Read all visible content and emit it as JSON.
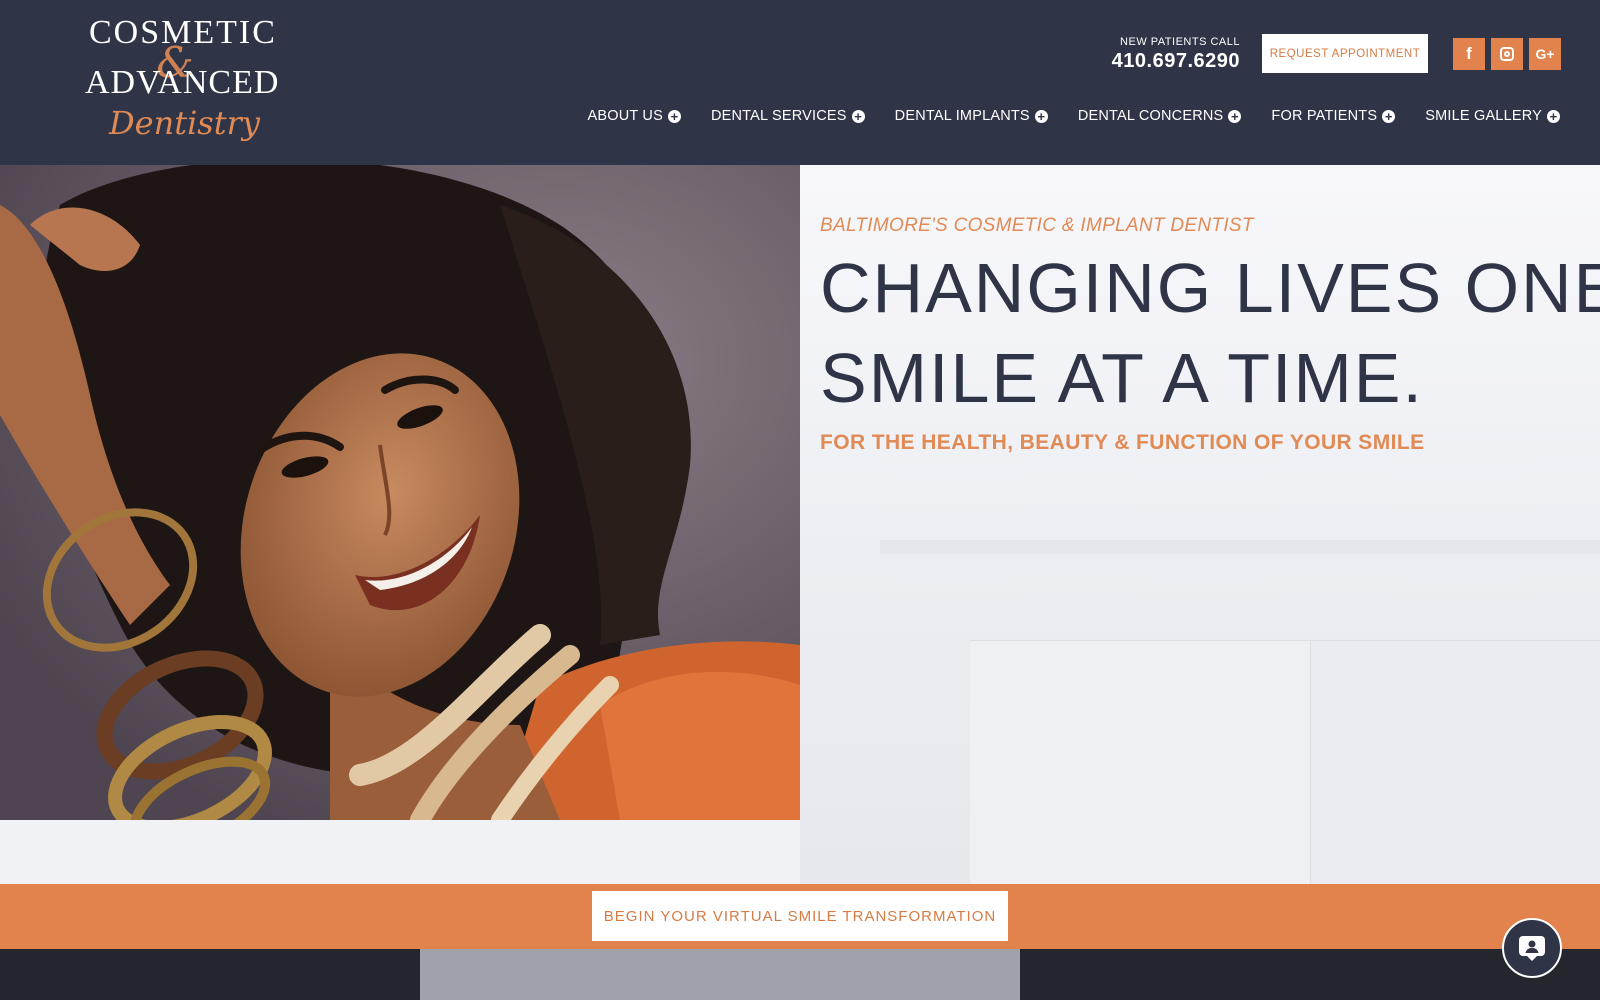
{
  "header": {
    "logo": {
      "line1": "COSMETIC",
      "ampersand": "&",
      "line2": "ADVANCED",
      "line3": "Dentistry"
    },
    "phone_label": "NEW PATIENTS CALL",
    "phone_number": "410.697.6290",
    "request_button": "REQUEST APPOINTMENT",
    "social": [
      {
        "name": "facebook-icon",
        "glyph": "f"
      },
      {
        "name": "instagram-icon",
        "glyph": ""
      },
      {
        "name": "google-plus-icon",
        "glyph": "G+"
      }
    ],
    "nav": [
      {
        "label": "ABOUT US"
      },
      {
        "label": "DENTAL SERVICES"
      },
      {
        "label": "DENTAL IMPLANTS"
      },
      {
        "label": "DENTAL CONCERNS"
      },
      {
        "label": "FOR PATIENTS"
      },
      {
        "label": "SMILE GALLERY"
      }
    ]
  },
  "hero": {
    "kicker": "BALTIMORE'S COSMETIC & IMPLANT DENTIST",
    "headline_line1": "CHANGING LIVES ONE",
    "headline_line2": "SMILE AT A TIME.",
    "subline": "FOR THE HEALTH, BEAUTY & FUNCTION OF YOUR SMILE"
  },
  "cta": {
    "label": "BEGIN YOUR VIRTUAL SMILE TRANSFORMATION"
  },
  "colors": {
    "navy": "#2f3547",
    "accent": "#e2834d",
    "white": "#ffffff"
  }
}
